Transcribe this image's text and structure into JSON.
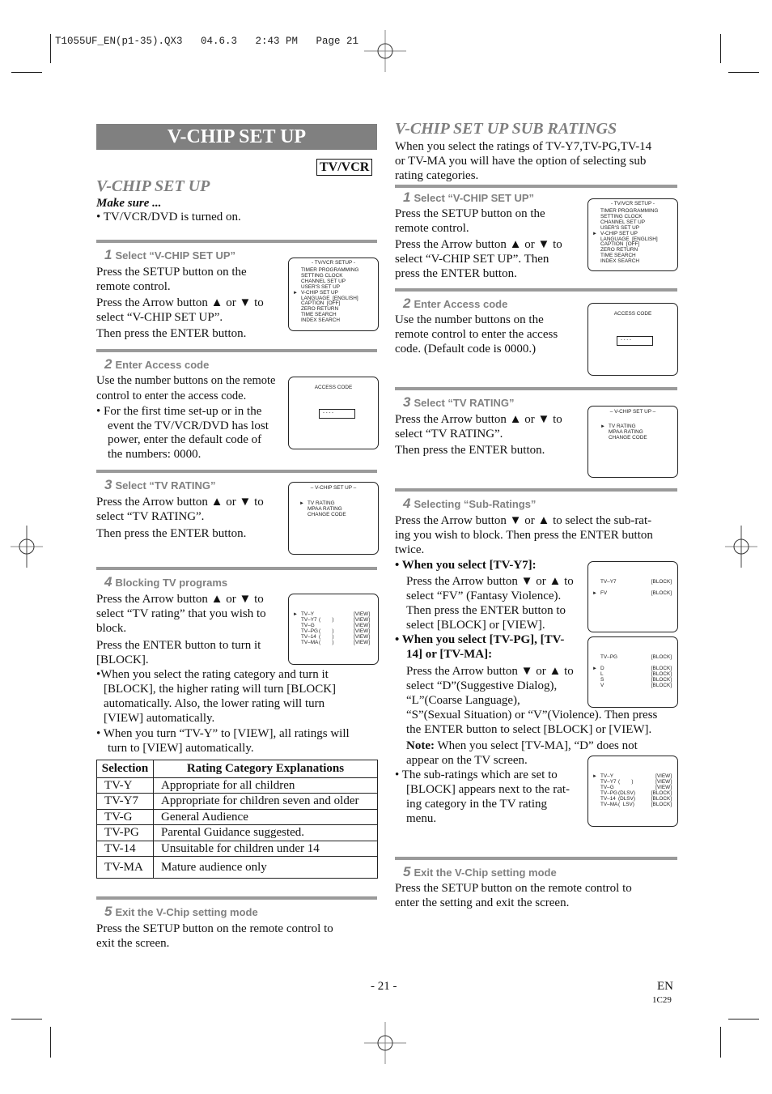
{
  "print_slug": "T1055UF_EN(p1-35).QX3   04.6.3   2:43 PM   Page 21",
  "page_banner": "V-CHIP SET UP",
  "device_badge": "TV/VCR",
  "left": {
    "title": "V-CHIP SET UP",
    "make_sure_label": "Make sure ...",
    "make_sure_item": "• TV/VCR/DVD is turned on.",
    "steps": [
      {
        "num": "1",
        "heading": "Select “V-CHIP SET UP”",
        "lines": [
          "Press the SETUP button on the",
          "remote control.",
          "Press the Arrow button ▲ or ▼ to",
          "select “V-CHIP SET UP”.",
          "Then press the ENTER button."
        ]
      },
      {
        "num": "2",
        "heading": "Enter Access code",
        "lines": [
          "Use the number buttons on the remote",
          "control to enter the access code."
        ],
        "bullet": [
          "• For the first time set-up or in the",
          "event the TV/VCR/DVD has lost",
          "power, enter the default code of",
          "the numbers: 0000."
        ]
      },
      {
        "num": "3",
        "heading": "Select “TV RATING”",
        "lines": [
          "Press the Arrow button ▲ or ▼ to",
          "select “TV RATING”.",
          "Then press the ENTER button."
        ]
      },
      {
        "num": "4",
        "heading": "Blocking TV programs",
        "lines": [
          "Press the Arrow button ▲ or ▼ to",
          "select “TV rating” that you wish to",
          "block.",
          "Press the ENTER button to turn it",
          "[BLOCK]."
        ],
        "notes": [
          [
            "•When you select the rating category and turn it",
            "[BLOCK], the higher rating will turn [BLOCK]",
            "automatically. Also, the lower rating will turn",
            "[VIEW] automatically."
          ],
          [
            "• When you turn “TV-Y” to [VIEW], all ratings will",
            "turn to [VIEW] automatically."
          ]
        ]
      },
      {
        "num": "5",
        "heading": "Exit the V-Chip setting mode",
        "lines": [
          "Press the SETUP button on the remote control to",
          "exit the screen."
        ]
      }
    ],
    "table": {
      "headers": [
        "Selection",
        "Rating Category Explanations"
      ],
      "rows": [
        [
          "TV-Y",
          "Appropriate for all children"
        ],
        [
          "TV-Y7",
          "Appropriate for children seven and older"
        ],
        [
          "TV-G",
          "General Audience"
        ],
        [
          "TV-PG",
          "Parental Guidance suggested."
        ],
        [
          "TV-14",
          "Unsuitable for children under 14"
        ],
        [
          "TV-MA",
          "Mature audience only"
        ]
      ]
    }
  },
  "right": {
    "title": "V-CHIP SET UP SUB RATINGS",
    "intro": [
      "When you select the ratings of TV-Y7,TV-PG,TV-14",
      "or TV-MA you will have the option of selecting sub",
      "rating categories."
    ],
    "steps": [
      {
        "num": "1",
        "heading": "Select “V-CHIP SET UP”",
        "lines": [
          "Press the SETUP button on the",
          "remote control.",
          "Press the Arrow button ▲ or ▼ to",
          "select “V-CHIP SET UP”. Then",
          "press the ENTER button."
        ]
      },
      {
        "num": "2",
        "heading": "Enter Access code",
        "lines": [
          "Use the number buttons on the",
          "remote control to enter the access",
          "code. (Default code is 0000.)"
        ]
      },
      {
        "num": "3",
        "heading": "Select “TV RATING”",
        "lines": [
          "Press the Arrow button ▲ or ▼ to",
          "select “TV RATING”.",
          "Then press the ENTER button."
        ]
      },
      {
        "num": "4",
        "heading": "Selecting “Sub-Ratings”",
        "lines": [
          "Press the Arrow button ▼ or ▲ to select the sub-rat-",
          "ing you wish to block. Then press the ENTER button",
          "twice."
        ],
        "y7_head": "• When you select [TV-Y7]:",
        "y7_lines": [
          "Press the Arrow button ▼ or ▲ to",
          "select “FV” (Fantasy Violence).",
          "Then press the ENTER button to",
          "select [BLOCK] or [VIEW]."
        ],
        "pg_head": [
          "• When you select [TV-PG], [TV-",
          "14] or [TV-MA]:"
        ],
        "pg_lines": [
          "Press the Arrow button ▼ or ▲ to",
          "select “D”(Suggestive Dialog),",
          "“L”(Coarse Language),",
          "“S”(Sexual Situation) or “V”(Violence). Then press",
          "the ENTER button to select [BLOCK] or [VIEW]."
        ],
        "note_label": "Note:",
        "note_text": " When you select [TV-MA], “D” does not",
        "note_text2": "appear on the TV screen.",
        "sub_note": [
          "• The sub-ratings which are set to",
          "[BLOCK] appears next to the rat-",
          "ing category in the TV rating",
          "menu."
        ]
      },
      {
        "num": "5",
        "heading": "Exit the V-Chip setting mode",
        "lines": [
          "Press the SETUP button on the remote control to",
          "enter the setting and exit the screen."
        ]
      }
    ]
  },
  "osd": {
    "setup_menu": {
      "title": "- TV/VCR SETUP -",
      "items": [
        "TIMER PROGRAMMING",
        "SETTING CLOCK",
        "CHANNEL SET UP",
        "USER'S SET UP",
        "V-CHIP SET UP",
        "LANGUAGE  [ENGLISH]",
        "CAPTION  [OFF]",
        "ZERO RETURN",
        "TIME SEARCH",
        "INDEX SEARCH"
      ],
      "selected_index": 4
    },
    "access_code": {
      "title": "ACCESS CODE",
      "entry": "- - - -"
    },
    "vchip_menu": {
      "title": "– V-CHIP SET UP –",
      "items": [
        "TV RATING",
        "MPAA RATING",
        "CHANGE CODE"
      ],
      "selected_index": 0
    },
    "tv_rating_view": {
      "rows": [
        {
          "label": "TV–Y",
          "sub": "",
          "value": "[VIEW]"
        },
        {
          "label": "TV–Y7",
          "sub": "(        )",
          "value": "[VIEW]"
        },
        {
          "label": "TV–G",
          "sub": "",
          "value": "[VIEW]"
        },
        {
          "label": "TV–PG",
          "sub": "(        )",
          "value": "[VIEW]"
        },
        {
          "label": "TV–14",
          "sub": "(        )",
          "value": "[VIEW]"
        },
        {
          "label": "TV–MA",
          "sub": "(        )",
          "value": "[VIEW]"
        }
      ],
      "selected_index": 0
    },
    "y7_sub": {
      "header": {
        "label": "TV–Y7",
        "value": "[BLOCK]"
      },
      "rows": [
        {
          "label": "FV",
          "value": "[BLOCK]"
        }
      ],
      "selected_index": 0
    },
    "pg_sub": {
      "header": {
        "label": "TV–PG",
        "value": "[BLOCK]"
      },
      "rows": [
        {
          "label": "D",
          "value": "[BLOCK]"
        },
        {
          "label": "L",
          "value": "[BLOCK]"
        },
        {
          "label": "S",
          "value": "[BLOCK]"
        },
        {
          "label": "V",
          "value": "[BLOCK]"
        }
      ],
      "selected_index": 0
    },
    "tv_rating_result": {
      "rows": [
        {
          "label": "TV–Y",
          "sub": "",
          "value": "[VIEW]"
        },
        {
          "label": "TV–Y7",
          "sub": "(        )",
          "value": "[VIEW]"
        },
        {
          "label": "TV–G",
          "sub": "",
          "value": "[VIEW]"
        },
        {
          "label": "TV–PG",
          "sub": "(DLSV)",
          "value": "[BLOCK]"
        },
        {
          "label": "TV–14",
          "sub": "(DLSV)",
          "value": "[BLOCK]"
        },
        {
          "label": "TV–MA",
          "sub": "(  LSV)",
          "value": "[BLOCK]"
        }
      ],
      "selected_index": 0
    }
  },
  "footer": {
    "page_number": "- 21 -",
    "lang": "EN",
    "code": "1C29"
  }
}
